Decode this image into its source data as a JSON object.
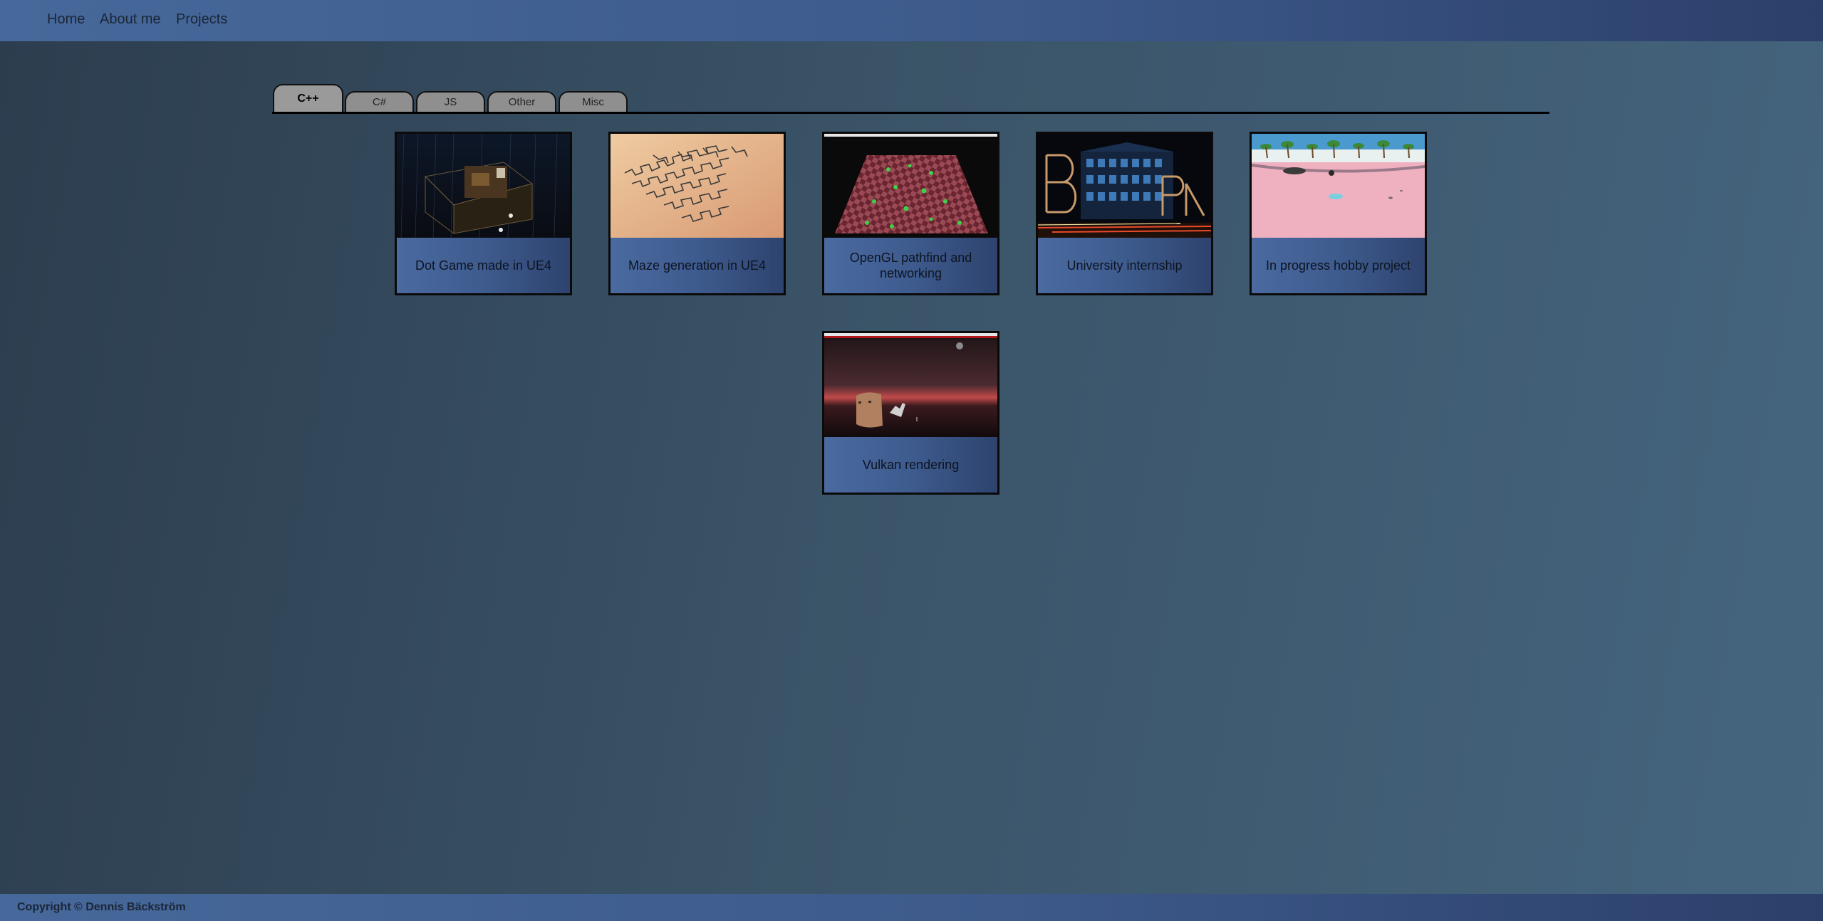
{
  "nav": {
    "links": [
      {
        "label": "Home"
      },
      {
        "label": "About me"
      },
      {
        "label": "Projects"
      }
    ]
  },
  "tabs": [
    {
      "label": "C++",
      "active": true
    },
    {
      "label": "C#",
      "active": false
    },
    {
      "label": "JS",
      "active": false
    },
    {
      "label": "Other",
      "active": false
    },
    {
      "label": "Misc",
      "active": false
    }
  ],
  "projects": [
    {
      "title": "Dot Game made in UE4",
      "thumbnail": "dot-game-thumbnail"
    },
    {
      "title": "Maze generation in UE4",
      "thumbnail": "maze-generation-thumbnail"
    },
    {
      "title": "OpenGL pathfind and networking",
      "thumbnail": "opengl-pathfind-thumbnail"
    },
    {
      "title": "University internship",
      "thumbnail": "university-internship-thumbnail"
    },
    {
      "title": "In progress hobby project",
      "thumbnail": "hobby-project-thumbnail"
    },
    {
      "title": "Vulkan rendering",
      "thumbnail": "vulkan-rendering-thumbnail"
    }
  ],
  "footer": {
    "copyright": "Copyright © Dennis Bäckström"
  }
}
